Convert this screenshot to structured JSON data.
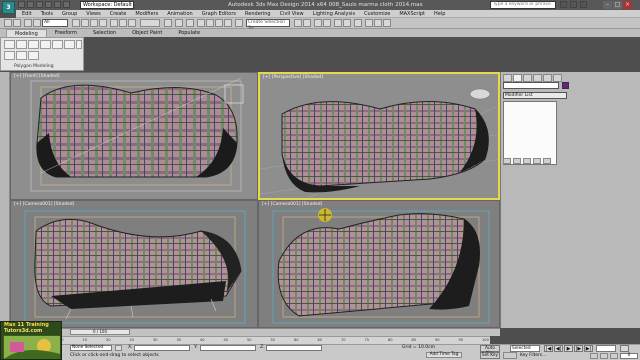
{
  "titlebar": {
    "logo": "3",
    "workspace": "Workspace: Default",
    "title": "Autodesk 3ds Max Design 2014 x64     008_Sauls marma cloth 2014.max",
    "search_placeholder": "Type a keyword or phrase"
  },
  "menubar": {
    "items": [
      "Edit",
      "Tools",
      "Group",
      "Views",
      "Create",
      "Modifiers",
      "Animation",
      "Graph Editors",
      "Rendering",
      "Civil View",
      "Lighting Analysis",
      "Customize",
      "MAXScript",
      "Help"
    ]
  },
  "maintoolbar": {
    "filter": "All",
    "selection_set": "Create Selection Se"
  },
  "ribbon": {
    "tabs": [
      "Modeling",
      "Freeform",
      "Selection",
      "Object Paint",
      "Populate"
    ],
    "active_tab": "Modeling",
    "panel_label": "Polygon Modeling"
  },
  "viewports": [
    {
      "label": "[+] [Front] [Shaded]",
      "active": false
    },
    {
      "label": "[+] [Perspective] [Shaded]",
      "active": true
    },
    {
      "label": "[+] [Camera001] [Shaded]",
      "active": false
    },
    {
      "label": "[+] [Camera001] [Shaded]",
      "active": false
    }
  ],
  "command_panel": {
    "modifier_list": "Modifier List"
  },
  "trackbar": {
    "frame_counter": "0 / 100",
    "ruler_ticks": [
      "0",
      "5",
      "10",
      "15",
      "20",
      "25",
      "30",
      "35",
      "40",
      "45",
      "50",
      "55",
      "60",
      "65",
      "70",
      "75",
      "80",
      "85",
      "90",
      "95",
      "100"
    ]
  },
  "statusbar": {
    "selection": "None Selected",
    "prompt": "Click or click-and-drag to select objects",
    "x_label": "X:",
    "y_label": "Y:",
    "z_label": "Z:",
    "grid": "Grid = 10.0cm",
    "add_time_tag": "Add Time Tag",
    "auto_key": "Auto Key",
    "set_key": "Set Key",
    "selected_option": "Selected",
    "key_filters": "Key Filters...",
    "frame": "0"
  },
  "badge": {
    "title": "Max 11 Training",
    "subtitle": "Tutors3d.com"
  },
  "colors": {
    "active_viewport_border": "#e7d84a",
    "viewport_bg": "#8e8e8e",
    "object_color": "#6a1e8a"
  }
}
